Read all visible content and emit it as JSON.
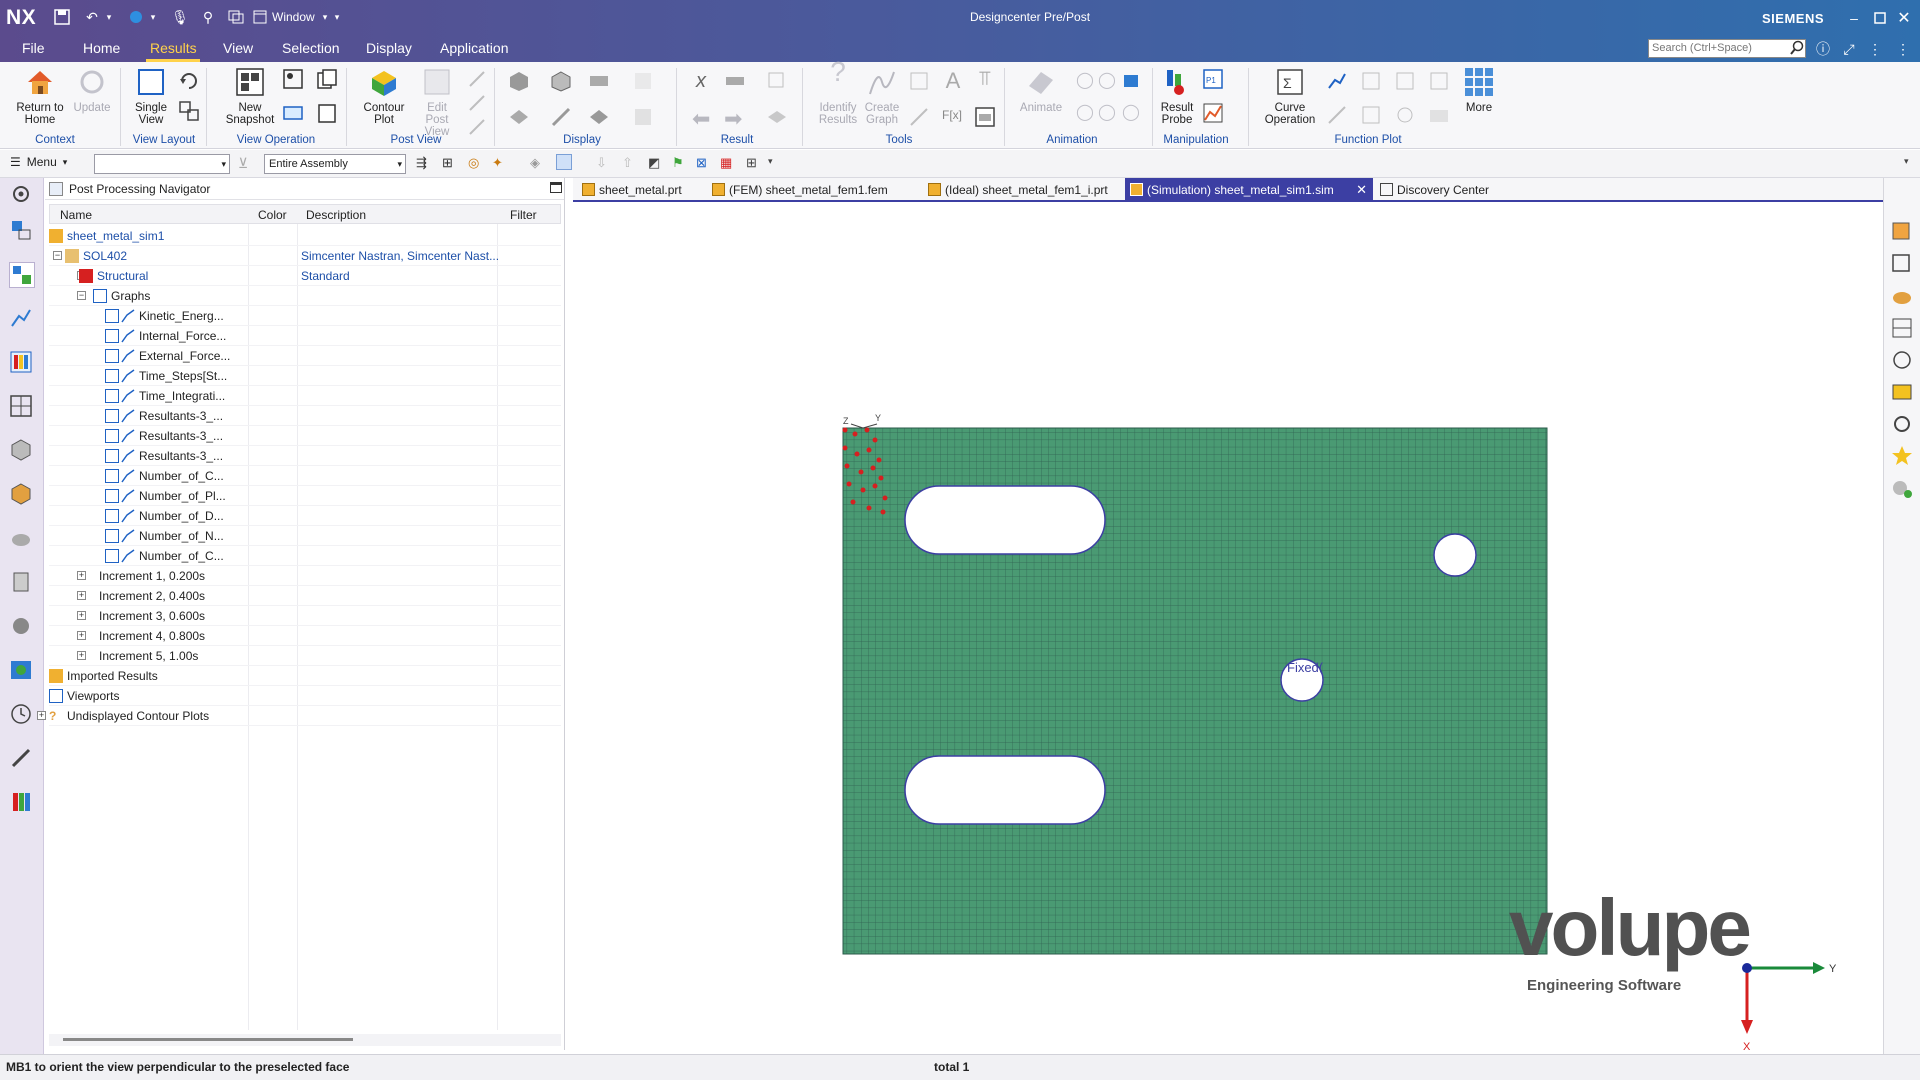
{
  "title_bar": {
    "app_logo": "NX",
    "window_menu": "Window",
    "app_title": "Designcenter Pre/Post",
    "brand": "SIEMENS"
  },
  "menu_tabs": [
    "File",
    "Home",
    "Results",
    "View",
    "Selection",
    "Display",
    "Application"
  ],
  "active_tab": "Results",
  "search": {
    "placeholder": "Search (Ctrl+Space)"
  },
  "ribbon": {
    "buttons": {
      "return_home": "Return to Home",
      "update": "Update",
      "single_view": "Single View",
      "new_snapshot": "New Snapshot",
      "contour_plot": "Contour Plot",
      "edit_post_view": "Edit Post View",
      "identify_results": "Identify Results",
      "create_graph": "Create Graph",
      "animate": "Animate",
      "result_probe": "Result Probe",
      "curve_operation": "Curve Operation",
      "more": "More"
    },
    "groups": {
      "context": "Context",
      "view_layout": "View Layout",
      "view_operation": "View Operation",
      "post_view": "Post View",
      "display": "Display",
      "result": "Result",
      "tools": "Tools",
      "animation": "Animation",
      "manipulation": "Manipulation",
      "function_plot": "Function Plot"
    }
  },
  "toolbar2": {
    "menu_label": "Menu",
    "filter_value": "",
    "assembly_scope": "Entire Assembly"
  },
  "navigator": {
    "title": "Post Processing Navigator",
    "columns": [
      "Name",
      "Color",
      "Description",
      "Filter"
    ],
    "rows": [
      {
        "label": "sheet_metal_sim1",
        "desc": ""
      },
      {
        "label": "SOL402",
        "desc": "Simcenter Nastran, Simcenter Nast..."
      },
      {
        "label": "Structural",
        "desc": "Standard"
      },
      {
        "label": "Graphs",
        "desc": ""
      },
      {
        "label": "Kinetic_Energ...",
        "desc": ""
      },
      {
        "label": "Internal_Force...",
        "desc": ""
      },
      {
        "label": "External_Force...",
        "desc": ""
      },
      {
        "label": "Time_Steps[St...",
        "desc": ""
      },
      {
        "label": "Time_Integrati...",
        "desc": ""
      },
      {
        "label": "Resultants-3_...",
        "desc": ""
      },
      {
        "label": "Resultants-3_...",
        "desc": ""
      },
      {
        "label": "Resultants-3_...",
        "desc": ""
      },
      {
        "label": "Number_of_C...",
        "desc": ""
      },
      {
        "label": "Number_of_Pl...",
        "desc": ""
      },
      {
        "label": "Number_of_D...",
        "desc": ""
      },
      {
        "label": "Number_of_N...",
        "desc": ""
      },
      {
        "label": "Number_of_C...",
        "desc": ""
      },
      {
        "label": "Increment 1, 0.200s",
        "desc": ""
      },
      {
        "label": "Increment 2, 0.400s",
        "desc": ""
      },
      {
        "label": "Increment 3, 0.600s",
        "desc": ""
      },
      {
        "label": "Increment 4, 0.800s",
        "desc": ""
      },
      {
        "label": "Increment 5, 1.00s",
        "desc": ""
      },
      {
        "label": "Imported Results",
        "desc": ""
      },
      {
        "label": "Viewports",
        "desc": ""
      },
      {
        "label": "Undisplayed Contour Plots",
        "desc": ""
      }
    ]
  },
  "doc_tabs": [
    "sheet_metal.prt",
    "(FEM) sheet_metal_fem1.fem",
    "(Ideal) sheet_metal_fem1_i.prt",
    "(Simulation) sheet_metal_sim1.sim",
    "Discovery Center"
  ],
  "viewport": {
    "fixed_label": "Fixed(",
    "triad_x": "X",
    "triad_y": "Y",
    "small_triad_y": "Y",
    "small_triad_z": "Z",
    "watermark_brand": "volupe",
    "watermark_sub": "Engineering Software",
    "mesh_color": "#4a9a73"
  },
  "status": {
    "message": "MB1 to orient the view perpendicular to the preselected face",
    "selection": "total 1"
  }
}
